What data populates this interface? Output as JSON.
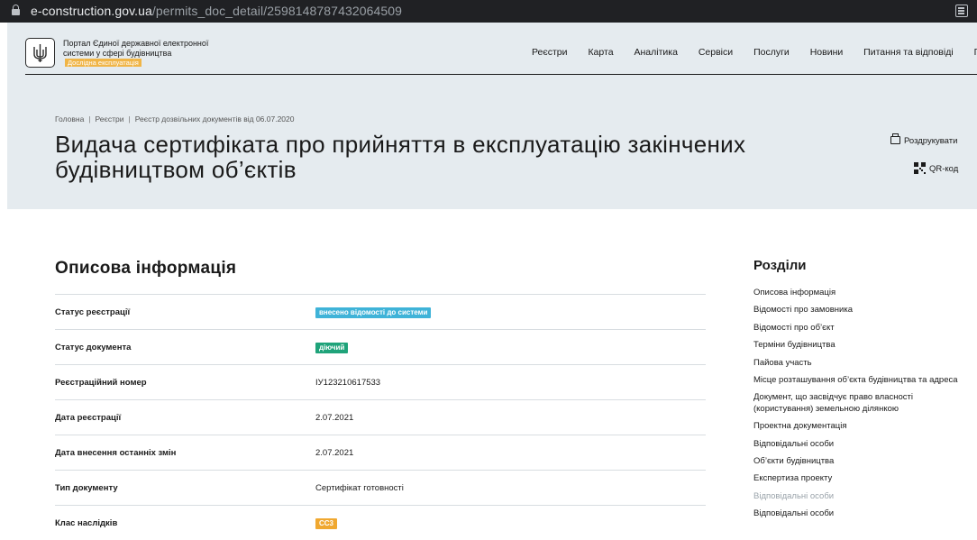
{
  "browser": {
    "url_host": "e-construction.gov.ua",
    "url_path": "/permits_doc_detail/2598148787432064509"
  },
  "header": {
    "portal_name": "Портал Єдиної державної електронної системи у сфері будівництва",
    "beta_label": "Дослідна експлуатація",
    "menu": [
      "Реєстри",
      "Карта",
      "Аналітика",
      "Сервіси",
      "Послуги",
      "Новини",
      "Питання та відповіді",
      "Пр"
    ],
    "breadcrumbs": [
      "Головна",
      "Реєстри",
      "Реєстр дозвільних документів від 06.07.2020"
    ],
    "title": "Видача сертифіката про прийняття в експлуатацію закінчених будівництвом об’єктів",
    "print_label": "Роздрукувати",
    "qr_label": "QR-код"
  },
  "main": {
    "section_title": "Описова інформація",
    "rows": [
      {
        "label": "Статус реєстрації",
        "value": "внесено відомості до системи",
        "badge": "blue"
      },
      {
        "label": "Статус документа",
        "value": "діючий",
        "badge": "green"
      },
      {
        "label": "Реєстраційний номер",
        "value": "ІУ123210617533"
      },
      {
        "label": "Дата реєстрації",
        "value": "2.07.2021"
      },
      {
        "label": "Дата внесення останніх змін",
        "value": "2.07.2021"
      },
      {
        "label": "Тип документу",
        "value": "Сертифікат готовності"
      },
      {
        "label": "Клас наслідків",
        "value": "СС3",
        "badge": "orange"
      }
    ]
  },
  "sidebar": {
    "title": "Розділи",
    "items": [
      "Описова інформація",
      "Відомості про замовника",
      "Відомості про об’єкт",
      "Терміни будівництва",
      "Пайова участь",
      "Місце розташування об’єкта будівництва та адреса",
      "Документ, що засвідчує право власності (користування) земельною ділянкою",
      "Проектна документація",
      "Відповідальні особи",
      "Об’єкти будівництва",
      "Експертиза проекту",
      "Відповідальні особи",
      "Відповідальні особи"
    ]
  },
  "colors": {
    "header_bg": "#e5ebef",
    "badge_blue": "#3fb3d8",
    "badge_green": "#1fa37a",
    "badge_orange": "#f0a830",
    "beta_bg": "#f0b547"
  }
}
